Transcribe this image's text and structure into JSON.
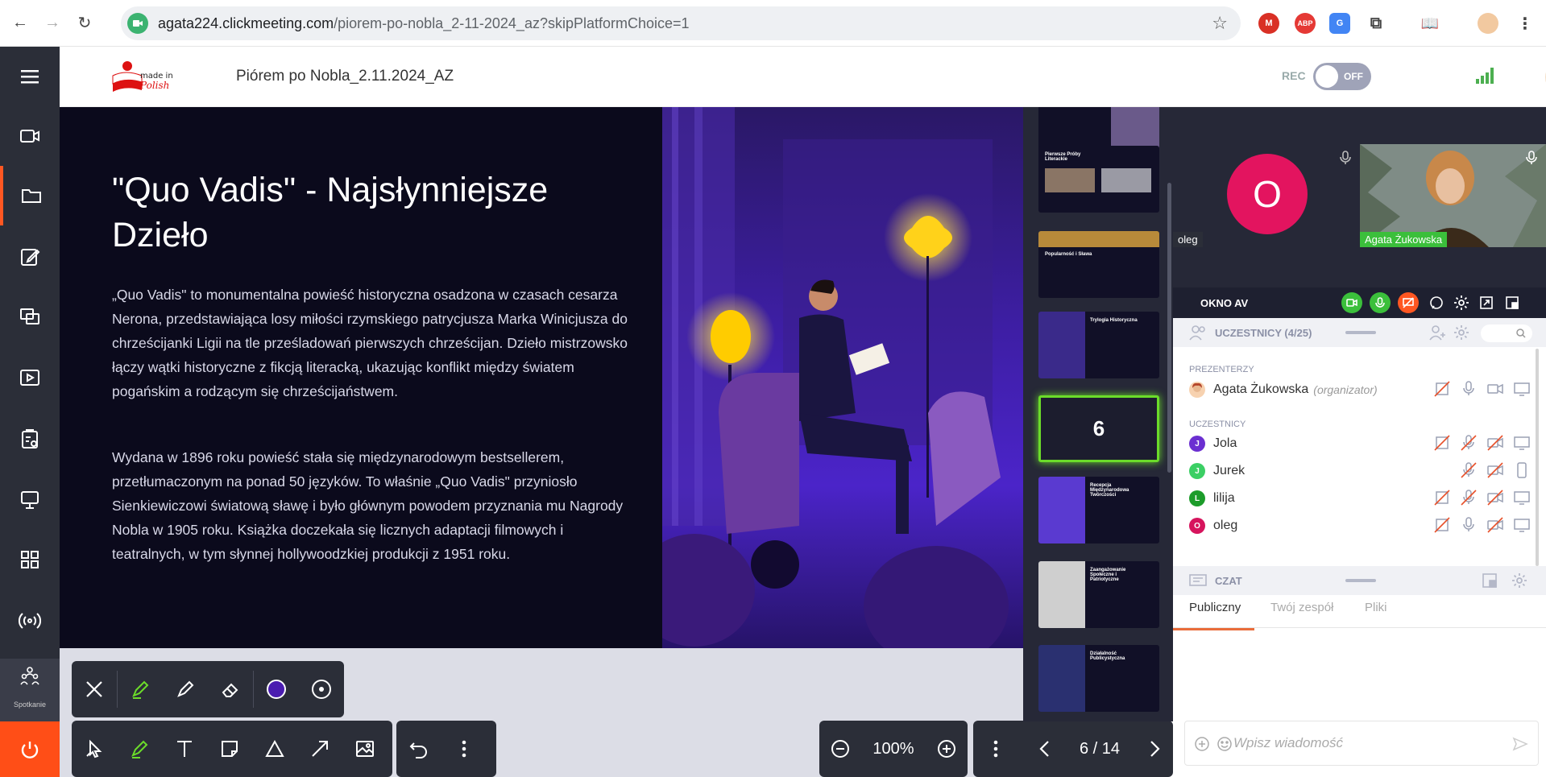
{
  "browser": {
    "url_host": "agata224.clickmeeting.com",
    "url_path": "/piorem-po-nobla_2-11-2024_az?skipPlatformChoice=1"
  },
  "header": {
    "meeting_title": "Piórem po Nobla_2.11.2024_AZ",
    "rec_label": "REC",
    "rec_state": "OFF"
  },
  "sidebar": {
    "meeting_label": "Spotkanie"
  },
  "slide": {
    "title": "\"Quo Vadis\" - Najsłynniejsze Dzieło",
    "paragraph1": "„Quo Vadis\" to monumentalna powieść historyczna osadzona w czasach cesarza Nerona, przedstawiająca losy miłości rzymskiego patrycjusza Marka Winicjusza do chrześcijanki Ligii na tle prześladowań pierwszych chrześcijan. Dzieło mistrzowsko łączy wątki historyczne z fikcją literacką, ukazując konflikt między światem pogańskim a rodzącym się chrześcijaństwem.",
    "paragraph2": "Wydana w 1896 roku powieść stała się międzynarodowym bestsellerem, przetłumaczonym na ponad 50 języków. To właśnie „Quo Vadis\" przyniosło Sienkiewiczowi światową sławę i było głównym powodem przyznania mu Nagrody Nobla w 1905 roku. Książka doczekała się licznych adaptacji filmowych i teatralnych, w tym słynnej hollywoodzkiej produkcji z 1951 roku."
  },
  "thumbnails": [
    {
      "title": "",
      "accent": "#5a3fd1"
    },
    {
      "title": "Pierwsze Próby Literackie",
      "accent": "#8a6b4a"
    },
    {
      "title": "Popularność i Sława",
      "accent": "#c9a23a"
    },
    {
      "title": "Trylogia Historyczna",
      "accent": "#4a3fb0"
    },
    {
      "title": "6",
      "accent": "#6bdc2a",
      "current": true
    },
    {
      "title": "Recepcja Międzynarodowa Twórczości",
      "accent": "#6a3fe0"
    },
    {
      "title": "Zaangażowanie Społeczne i Patriotyczne",
      "accent": "#888888"
    },
    {
      "title": "Działalność Publicystyczna",
      "accent": "#3a3f8a"
    }
  ],
  "toolbar": {
    "zoom": "100%",
    "page": "6 / 14"
  },
  "video": {
    "tile1_name": "oleg",
    "tile1_initial": "O",
    "tile2_name": "Agata Żukowska"
  },
  "okno": {
    "title": "OKNO AV"
  },
  "participants": {
    "header": "UCZESTNICY (4/25)",
    "presenters_label": "PREZENTERZY",
    "participants_label": "UCZESTNICY",
    "presenters": [
      {
        "name": "Agata Żukowska",
        "role": "(organizator)"
      }
    ],
    "list": [
      {
        "initial": "J",
        "name": "Jola",
        "color": "#6b2fd1"
      },
      {
        "initial": "J",
        "name": "Jurek",
        "color": "#3bcf64"
      },
      {
        "initial": "L",
        "name": "lilija",
        "color": "#1c9c2a"
      },
      {
        "initial": "O",
        "name": "oleg",
        "color": "#d6145d"
      }
    ]
  },
  "chat": {
    "header": "CZAT",
    "tabs": [
      "Publiczny",
      "Twój zespół",
      "Pliki"
    ],
    "placeholder": "Wpisz wiadomość"
  },
  "colors": {
    "accent_orange": "#ff4e17",
    "sidebar_bg": "#2b2e38",
    "green_active": "#6bdc2a"
  }
}
